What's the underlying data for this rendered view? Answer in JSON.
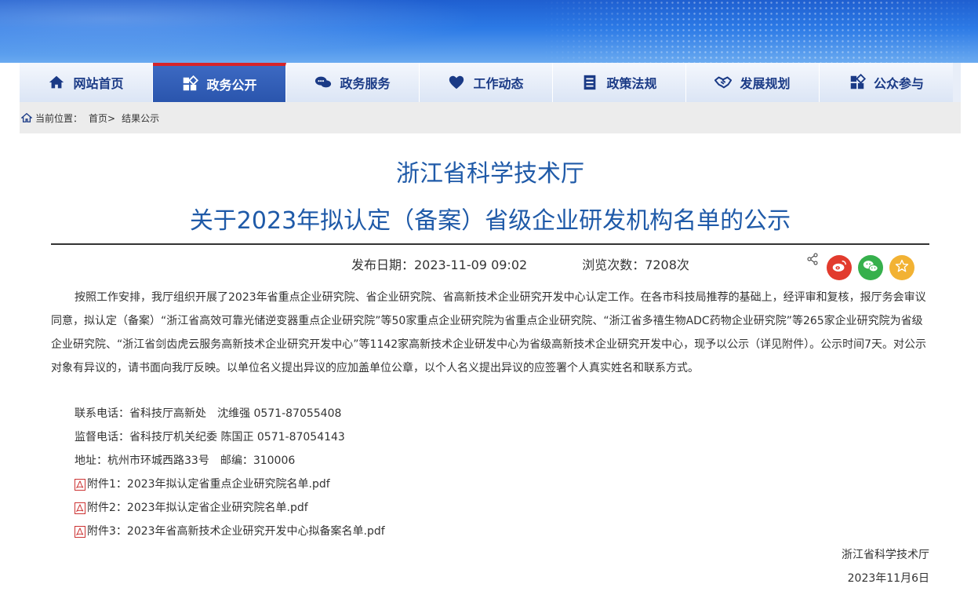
{
  "nav": {
    "items": [
      {
        "label": "网站首页",
        "icon": "home-icon",
        "active": false
      },
      {
        "label": "政务公开",
        "icon": "open-government-icon",
        "active": true
      },
      {
        "label": "政务服务",
        "icon": "chat-bubbles-icon",
        "active": false
      },
      {
        "label": "工作动态",
        "icon": "heart-icon",
        "active": false
      },
      {
        "label": "政策法规",
        "icon": "document-list-icon",
        "active": false
      },
      {
        "label": "发展规划",
        "icon": "handshake-icon",
        "active": false
      },
      {
        "label": "公众参与",
        "icon": "participation-icon",
        "active": false
      }
    ],
    "active_color": "#2a55ad",
    "active_top_border": "#d6242a"
  },
  "breadcrumb": {
    "prefix": "当前位置：",
    "home": "首页>",
    "current": "结果公示"
  },
  "article": {
    "org_title": "浙江省科学技术厅",
    "title": "关于2023年拟认定（备案）省级企业研发机构名单的公示",
    "publish_date": "发布日期：2023-11-09 09:02",
    "views": "浏览次数：7208次",
    "body": "按照工作安排，我厅组织开展了2023年省重点企业研究院、省企业研究院、省高新技术企业研究开发中心认定工作。在各市科技局推荐的基础上，经评审和复核，报厅务会审议同意，拟认定（备案）“浙江省高效可靠光储逆变器重点企业研究院”等50家重点企业研究院为省重点企业研究院、“浙江省多禧生物ADC药物企业研究院”等265家企业研究院为省级企业研究院、“浙江省剑齿虎云服务高新技术企业研究开发中心”等1142家高新技术企业研发中心为省级高新技术企业研究开发中心，现予以公示（详见附件）。公示时间7天。对公示对象有异议的，请书面向我厅反映。以单位名义提出异议的应加盖单位公章，以个人名义提出异议的应签署个人真实姓名和联系方式。",
    "contact": "联系电话：省科技厅高新处　沈维强 0571-87055408",
    "supervise": "监督电话：省科技厅机关纪委  陈国正 0571-87054143",
    "address": "地址：杭州市环城西路33号　邮编：310006",
    "attachments": [
      "附件1：2023年拟认定省重点企业研究院名单.pdf",
      "附件2：2023年拟认定省企业研究院名单.pdf",
      "附件3：2023年省高新技术企业研究开发中心拟备案名单.pdf"
    ],
    "signature_org": "浙江省科学技术厅",
    "signature_date": "2023年11月6日"
  },
  "colors": {
    "title": "#1f5aa8",
    "weibo": "#e23b2d",
    "wechat": "#36b04c",
    "favorite": "#f2b233"
  }
}
